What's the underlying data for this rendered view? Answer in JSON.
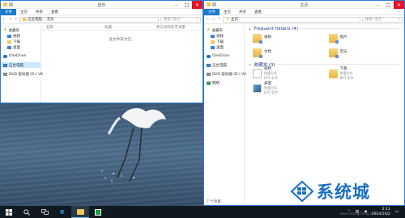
{
  "left_window": {
    "title": "音乐",
    "ribbon_tabs": [
      "文件",
      "主页",
      "共享",
      "查看"
    ],
    "address_path": [
      "这台电脑",
      "音乐"
    ],
    "search_placeholder": "搜索\"音乐\"",
    "columns": [
      "名称",
      "",
      "标题",
      "参与创作的艺术家"
    ],
    "empty_message": "此文件夹为空。",
    "nav": [
      {
        "label": "收藏夹",
        "icon": "star-icon",
        "indent": false,
        "selected": false
      },
      {
        "label": "视频",
        "icon": "video-folder-icon",
        "indent": true,
        "selected": false
      },
      {
        "label": "下载",
        "icon": "download-folder-icon",
        "indent": true,
        "selected": false
      },
      {
        "label": "桌面",
        "icon": "desktop-folder-icon",
        "indent": true,
        "selected": false
      },
      {
        "label": "OneDrive",
        "icon": "cloud-icon",
        "indent": false,
        "selected": false
      },
      {
        "label": "这台电脑",
        "icon": "computer-icon",
        "indent": false,
        "selected": true
      },
      {
        "label": "DVD 驱动器 (D:) VA",
        "icon": "dvd-drive-icon",
        "indent": false,
        "selected": false
      }
    ]
  },
  "right_window": {
    "title": "主页",
    "ribbon_tabs": [
      "文件",
      "主页",
      "共享",
      "查看"
    ],
    "address_path": [
      "主页"
    ],
    "search_placeholder": "搜索\"主页\"",
    "frequent_header": "Frequent folders (4)",
    "frequent": [
      {
        "name": "视频",
        "sub": "",
        "icon": "video-folder-icon"
      },
      {
        "name": "图片",
        "sub": "",
        "icon": "pictures-folder-icon"
      },
      {
        "name": "文档",
        "sub": "",
        "icon": "documents-folder-icon"
      },
      {
        "name": "音乐",
        "sub": "",
        "icon": "music-folder-icon"
      }
    ],
    "favorites_header": "收藏夹 (3)",
    "favorites": [
      {
        "name": "视频",
        "sub": "快速方式",
        "size": "675 字节",
        "icon": "video-shortcut-icon"
      },
      {
        "name": "下载",
        "sub": "快速方式",
        "size": "897 字节",
        "icon": "download-shortcut-icon"
      },
      {
        "name": "桌面",
        "sub": "快速方式",
        "size": "675 字节",
        "icon": "desktop-shortcut-icon"
      }
    ],
    "nav": [
      {
        "label": "收藏夹",
        "icon": "star-icon",
        "indent": false,
        "selected": false
      },
      {
        "label": "视频",
        "icon": "video-folder-icon",
        "indent": true,
        "selected": false
      },
      {
        "label": "下载",
        "icon": "download-folder-icon",
        "indent": true,
        "selected": false
      },
      {
        "label": "桌面",
        "icon": "desktop-folder-icon",
        "indent": true,
        "selected": false
      },
      {
        "label": "OneDrive",
        "icon": "cloud-icon",
        "indent": false,
        "selected": false
      },
      {
        "label": "这台电脑",
        "icon": "computer-icon",
        "indent": false,
        "selected": false
      },
      {
        "label": "DVD 驱动器 (D:) VA",
        "icon": "dvd-drive-icon",
        "indent": false,
        "selected": false
      },
      {
        "label": "网络",
        "icon": "network-icon",
        "indent": false,
        "selected": false
      }
    ],
    "status": "7 个项目"
  },
  "taskbar": {
    "clock_time": "2:11",
    "clock_date": "2014/10/2"
  },
  "watermark": {
    "text": "系统城",
    "url": "www.xitongcheng.com"
  },
  "colors": {
    "accent": "#1979ca",
    "close": "#e81123",
    "header": "#1e3287"
  }
}
